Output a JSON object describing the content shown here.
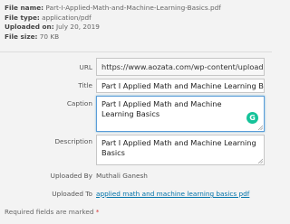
{
  "file_info": {
    "name_label": "File name:",
    "name_value": "Part-I-Applied-Math-and-Machine-Learning-Basics.pdf",
    "type_label": "File type:",
    "type_value": "application/pdf",
    "uploaded_label": "Uploaded on:",
    "uploaded_value": "July 20, 2019",
    "size_label": "File size:",
    "size_value": "70 KB"
  },
  "fields": {
    "url_label": "URL",
    "url_value": "https://www.aozata.com/wp-content/uploads/",
    "title_label": "Title",
    "title_value": "Part I Applied Math and Machine Learning Basic",
    "caption_label": "Caption",
    "caption_value": "Part I Applied Math and Machine Learning Basics",
    "description_label": "Description",
    "description_value": "Part I Applied Math and Machine Learning Basics"
  },
  "meta": {
    "uploaded_by_label": "Uploaded By",
    "uploaded_by_value": "Muthali Ganesh",
    "uploaded_to_label": "Uploaded To",
    "uploaded_to_value": "applied math and machine learning basics pdf"
  },
  "footer": {
    "required_text": "Required fields are marked",
    "required_star": "*"
  },
  "icons": {
    "grammarly_glyph": "G",
    "grammarly_color": "#15c39a"
  },
  "colors": {
    "link": "#0073aa",
    "focus_border": "#5b9dd9",
    "required_star": "#d63638"
  }
}
